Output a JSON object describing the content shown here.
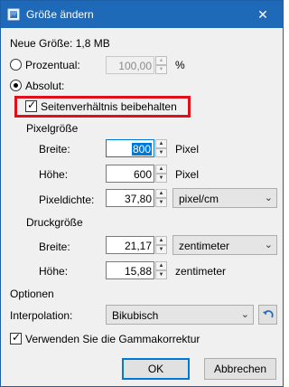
{
  "window": {
    "title": "Größe ändern",
    "close_glyph": "✕"
  },
  "new_size": {
    "label": "Neue Größe: 1,8 MB"
  },
  "mode": {
    "percent": {
      "label": "Prozentual:",
      "value": "100,00",
      "unit": "%",
      "selected": false
    },
    "absolute": {
      "label": "Absolut:",
      "selected": true
    }
  },
  "aspect": {
    "label": "Seitenverhältnis beibehalten",
    "checked": true
  },
  "pixel_size": {
    "heading": "Pixelgröße",
    "width": {
      "label": "Breite:",
      "value": "800",
      "unit": "Pixel"
    },
    "height": {
      "label": "Höhe:",
      "value": "600",
      "unit": "Pixel"
    },
    "density": {
      "label": "Pixeldichte:",
      "value": "37,80",
      "unit": "pixel/cm"
    }
  },
  "print_size": {
    "heading": "Druckgröße",
    "width": {
      "label": "Breite:",
      "value": "21,17",
      "unit": "zentimeter"
    },
    "height": {
      "label": "Höhe:",
      "value": "15,88",
      "unit": "zentimeter"
    }
  },
  "options": {
    "heading": "Optionen",
    "interpolation": {
      "label": "Interpolation:",
      "value": "Bikubisch"
    },
    "gamma": {
      "label": "Verwenden Sie die Gammakorrektur",
      "checked": true
    }
  },
  "buttons": {
    "ok": "OK",
    "cancel": "Abbrechen"
  },
  "colors": {
    "titlebar": "#1e6ab8",
    "highlight": "#e0101a",
    "selection": "#0078d7"
  }
}
